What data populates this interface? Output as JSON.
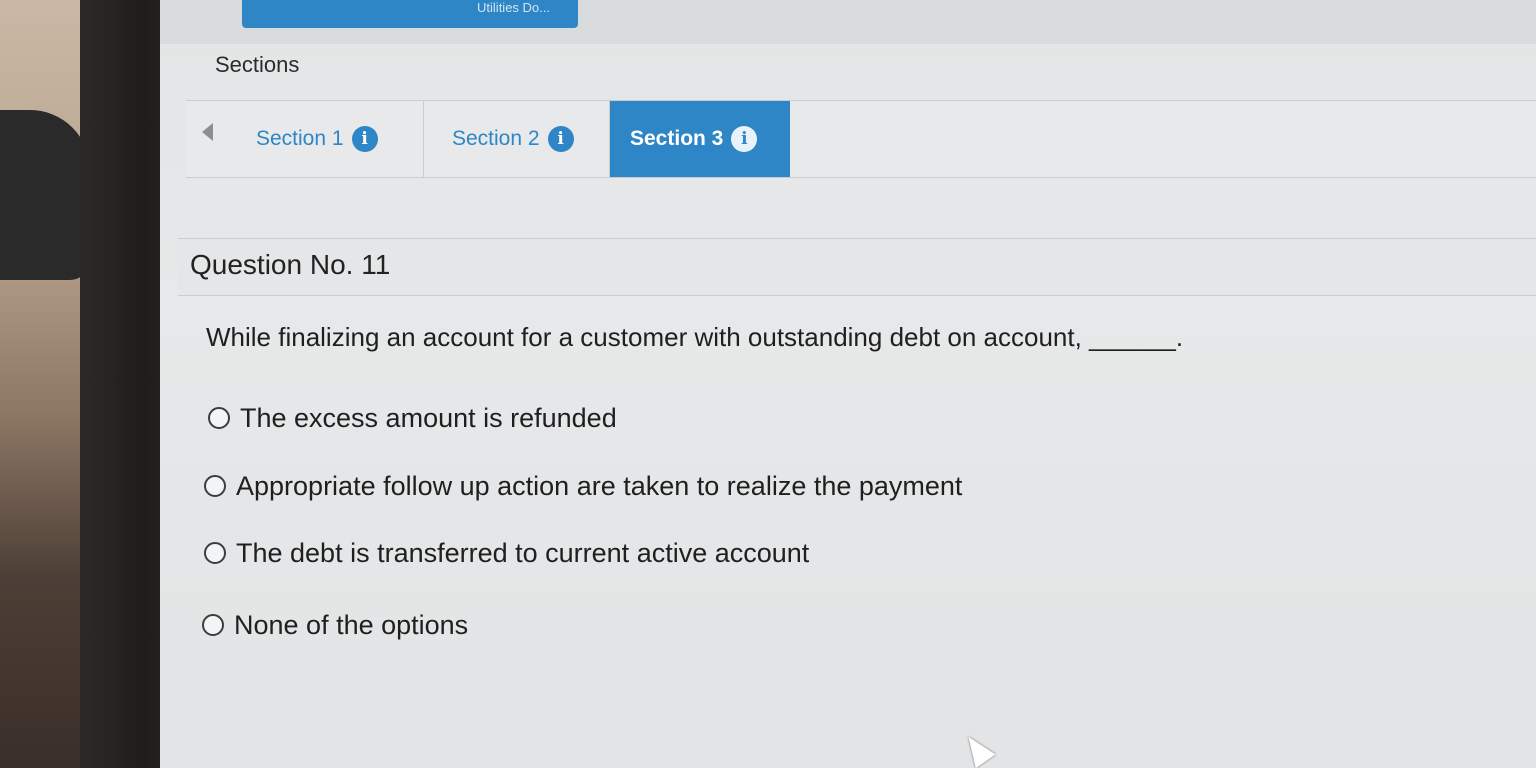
{
  "top_badge": {
    "text": "Utilities Do..."
  },
  "sections": {
    "label": "Sections",
    "tabs": [
      {
        "label": "Section 1",
        "icon": "info-icon",
        "active": false
      },
      {
        "label": "Section 2",
        "icon": "info-icon",
        "active": false
      },
      {
        "label": "Section 3",
        "icon": "info-icon",
        "active": true
      }
    ]
  },
  "question": {
    "title": "Question No. 11",
    "text": "While finalizing an account for a customer with outstanding debt on account, ______.",
    "options": [
      {
        "label": "The excess amount is refunded",
        "selected": false
      },
      {
        "label": "Appropriate follow up action are taken to realize the payment",
        "selected": false
      },
      {
        "label": "The debt is transferred to current active account",
        "selected": false
      },
      {
        "label": "None of the options",
        "selected": false
      }
    ]
  },
  "colors": {
    "accent": "#2f86c6",
    "text": "#1f1f1f",
    "background": "#e5e7e8"
  }
}
